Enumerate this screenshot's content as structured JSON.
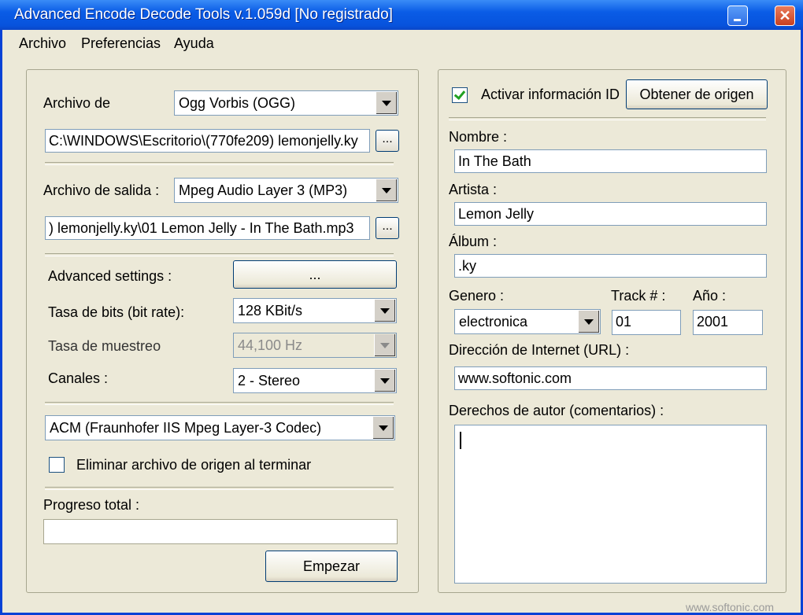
{
  "window": {
    "title": "Advanced Encode Decode Tools v.1.059d [No registrado]",
    "close_glyph": "✕"
  },
  "menu": [
    "Archivo",
    "Preferencias",
    "Ayuda"
  ],
  "input": {
    "label": "Archivo de",
    "format": "Ogg Vorbis (OGG)",
    "path": "C:\\WINDOWS\\Escritorio\\(770fe209) lemonjelly.ky",
    "browse": "..."
  },
  "output": {
    "label": "Archivo de salida :",
    "format": "Mpeg Audio Layer 3 (MP3)",
    "path": ") lemonjelly.ky\\01 Lemon Jelly - In The Bath.mp3",
    "browse": "..."
  },
  "advanced": {
    "label": "Advanced settings :",
    "button": "..."
  },
  "bitrate": {
    "label": "Tasa de bits (bit rate):",
    "value": "128 KBit/s"
  },
  "samplerate": {
    "label": "Tasa de muestreo",
    "value": "44,100 Hz",
    "enabled": false
  },
  "channels": {
    "label": "Canales :",
    "value": "2 - Stereo"
  },
  "codec": {
    "value": "ACM (Fraunhofer IIS Mpeg Layer-3 Codec)"
  },
  "delete_source": {
    "label": "Eliminar archivo de origen al terminar",
    "checked": false
  },
  "progress": {
    "label": "Progreso total :",
    "value": 0
  },
  "start_button": "Empezar",
  "id3": {
    "enable_label": "Activar información ID",
    "enabled": true,
    "fetch_button": "Obtener de origen",
    "name_label": "Nombre :",
    "name": "In The Bath",
    "artist_label": "Artista :",
    "artist": "Lemon Jelly",
    "album_label": "Álbum :",
    "album": ".ky",
    "genre_label": "Genero :",
    "genre": "electronica",
    "track_label": "Track # :",
    "track": "01",
    "year_label": "Año :",
    "year": "2001",
    "url_label": "Dirección de Internet (URL) :",
    "url": "www.softonic.com",
    "copyright_label": "Derechos de autor (comentarios) :",
    "copyright": ""
  },
  "watermark": "www.softonic.com"
}
